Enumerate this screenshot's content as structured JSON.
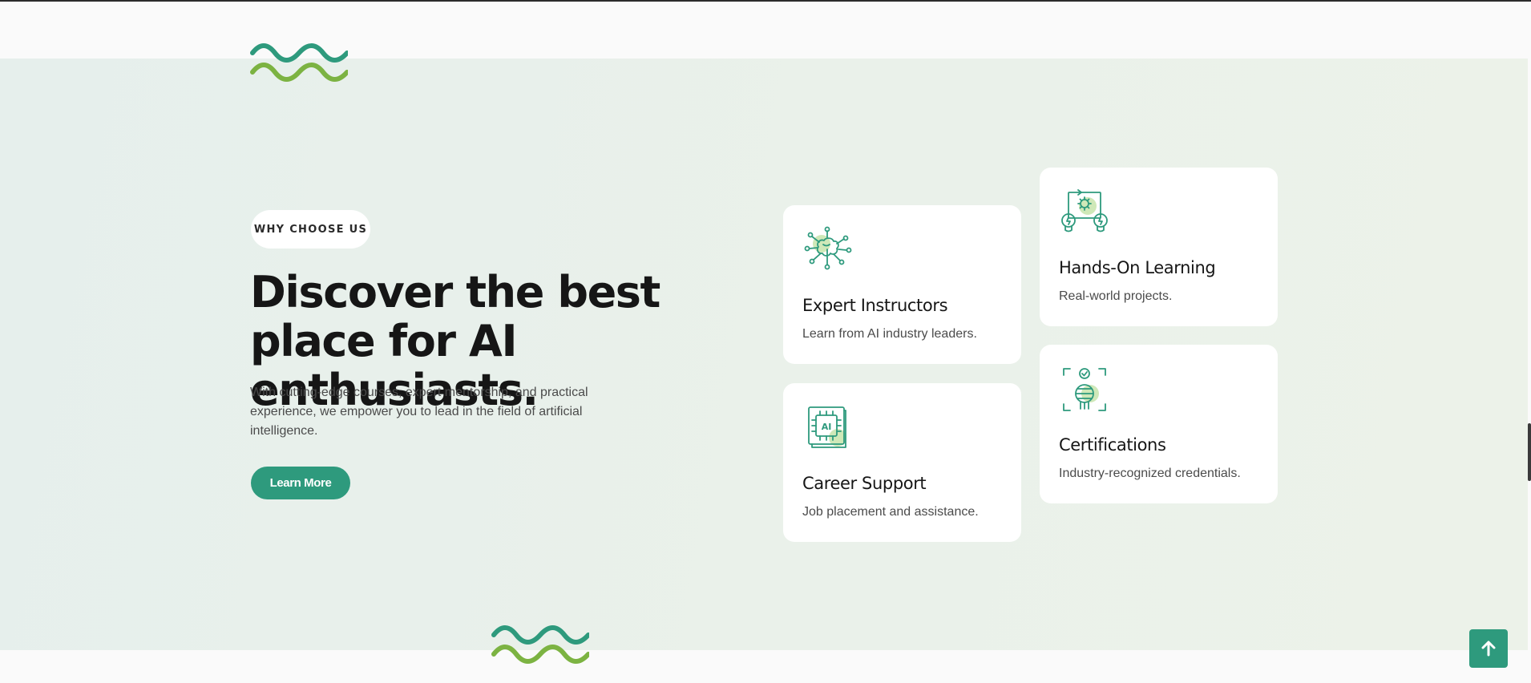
{
  "colors": {
    "accent": "#2e9a7d",
    "wave_teal": "#2e9a7d",
    "wave_green": "#7cb342",
    "icon_highlight": "#cfe8b8",
    "section_bg": "#e8f0ec"
  },
  "section": {
    "badge": "WHY CHOOSE US",
    "headline": "Discover the best place for AI enthusiasts.",
    "description": "With cutting-edge courses, expert mentorship, and practical experience, we empower you to lead in the field of artificial intelligence.",
    "button_label": "Learn More"
  },
  "features": [
    {
      "icon": "brain-network-icon",
      "title": "Expert Instructors",
      "text": "Learn from AI industry leaders."
    },
    {
      "icon": "lightbulb-gear-icon",
      "title": "Hands-On Learning",
      "text": "Real-world projects."
    },
    {
      "icon": "ai-chip-book-icon",
      "title": "Career Support",
      "text": "Job placement and assistance."
    },
    {
      "icon": "certificate-scan-icon",
      "title": "Certifications",
      "text": "Industry-recognized credentials."
    }
  ],
  "decor": {
    "top_wave": "wave-icon",
    "bottom_wave": "wave-icon"
  },
  "scroll_to_top": {
    "icon": "arrow-up-icon"
  }
}
